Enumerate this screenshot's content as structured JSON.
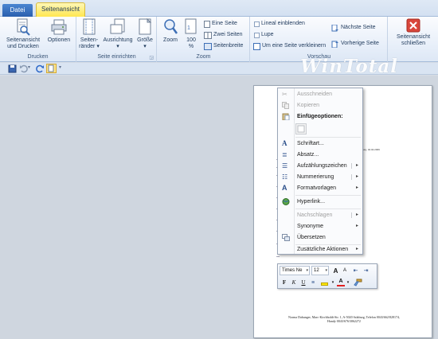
{
  "tabs": {
    "file": "Datei",
    "active": "Seitenansicht"
  },
  "groups": {
    "print": {
      "label": "Drucken",
      "print_preview": [
        "Seitenansicht",
        "und Drucken"
      ],
      "options": "Optionen"
    },
    "page_setup": {
      "label": "Seite einrichten",
      "margins": [
        "Seiten-",
        "ränder"
      ],
      "orientation": "Ausrichtung",
      "size": "Größe"
    },
    "zoom": {
      "label": "Zoom",
      "zoom": "Zoom",
      "percent": [
        "100",
        "%"
      ],
      "one_page": "Eine Seite",
      "two_pages": "Zwei Seiten",
      "page_width": "Seitenbreite"
    },
    "preview": {
      "label": "Vorschau",
      "show_ruler": "Lineal einblenden",
      "magnifier": "Lupe",
      "shrink_one_page": "Um eine Seite verkleinern",
      "next_page": "Nächste Seite",
      "prev_page": "Vorherige Seite"
    },
    "close": {
      "label": [
        "Seitenansicht",
        "schließen"
      ]
    }
  },
  "logo": "WinTotal",
  "page": {
    "date_line": "lzburg, 04.02.2009",
    "footer": [
      "Norma Dabunger, Marc-Kirchholdt-Str. 1, A-5020 Salzburg, Telefon 0043/662/828174,",
      "Handy 0043/676/3062272"
    ]
  },
  "context_menu": {
    "cut": "Ausschneiden",
    "copy": "Kopieren",
    "paste_options": "Einfügeoptionen:",
    "font": "Schriftart...",
    "paragraph": "Absatz...",
    "bullets": "Aufzählungszeichen",
    "numbering": "Nummerierung",
    "styles": "Formatvorlagen",
    "hyperlink": "Hyperlink...",
    "lookup": "Nachschlagen",
    "synonyms": "Synonyme",
    "translate": "Übersetzen",
    "additional_actions": "Zusätzliche Aktionen"
  },
  "mini_toolbar": {
    "font_name": "Times Ne",
    "font_size": "12",
    "grow": "A",
    "shrink": "A",
    "bold": "F",
    "italic": "K",
    "underline": "U",
    "font_color_letter": "A"
  },
  "colors": {
    "active_tab": "#ffe64a",
    "file_tab": "#2a5fae",
    "close_red": "#d9463b",
    "text": "#1e395b"
  }
}
